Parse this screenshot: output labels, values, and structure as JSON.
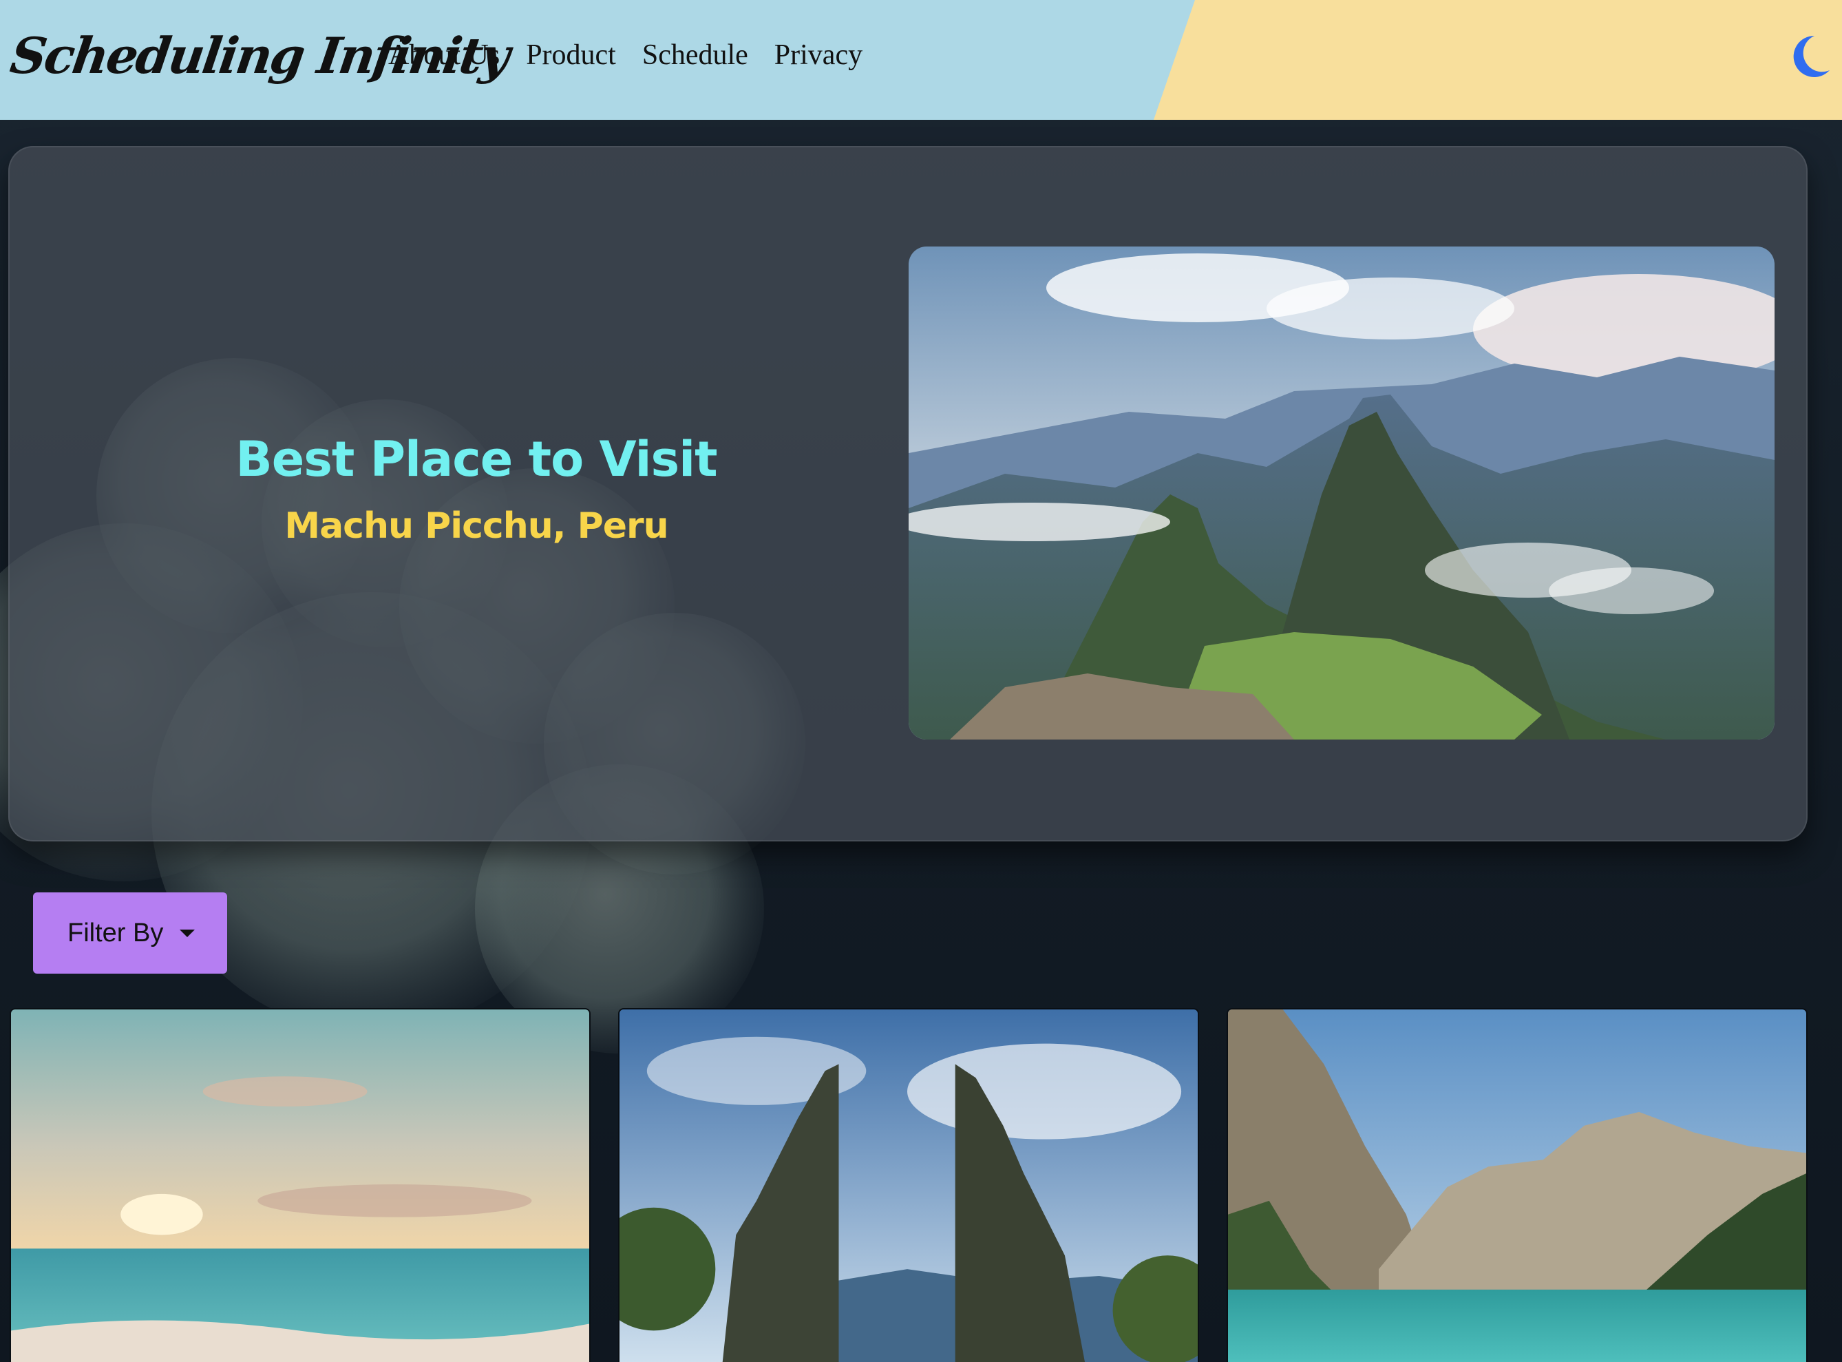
{
  "navbar": {
    "brand": "Scheduling Infinity",
    "links": [
      {
        "label": "About Us"
      },
      {
        "label": "Product"
      },
      {
        "label": "Schedule"
      },
      {
        "label": "Privacy"
      }
    ],
    "theme_icon": "moon-icon",
    "colors": {
      "left": "#add8e6",
      "right": "#f8df9c",
      "icon": "#2f6df0"
    }
  },
  "hero": {
    "title": "Best Place to Visit",
    "subtitle": "Machu Picchu, Peru",
    "image": "machu-picchu-photo",
    "colors": {
      "title": "#72f0f0",
      "subtitle": "#f8d54a"
    }
  },
  "filter": {
    "label": "Filter By",
    "icon": "caret-down-icon",
    "color": "#b57ef2"
  },
  "cards": [
    {
      "image": "beach-sunset-photo"
    },
    {
      "image": "bali-temple-gate-photo"
    },
    {
      "image": "mountain-lake-photo"
    }
  ]
}
